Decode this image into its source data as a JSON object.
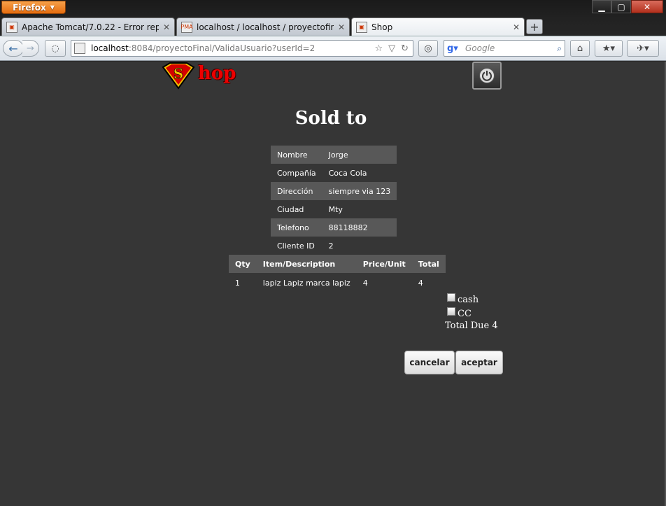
{
  "browser": {
    "menu_label": "Firefox",
    "tabs": [
      {
        "title": "Apache Tomcat/7.0.22 - Error report",
        "favicon": "tomcat-icon",
        "active": false
      },
      {
        "title": "localhost / localhost / proyectofinal / ...",
        "favicon": "pma-icon",
        "active": false
      },
      {
        "title": "Shop",
        "favicon": "page-icon",
        "active": true
      }
    ],
    "url_host": "localhost",
    "url_path": ":8084/proyectoFinal/ValidaUsuario?userId=2",
    "search_placeholder": "Google",
    "window_controls": [
      "minimize",
      "maximize",
      "close"
    ]
  },
  "page": {
    "logo_text": "hop",
    "heading": "Sold to",
    "customer": [
      {
        "label": "Nombre",
        "value": "Jorge"
      },
      {
        "label": "Compañía",
        "value": "Coca Cola"
      },
      {
        "label": "Dirección",
        "value": "siempre via 123"
      },
      {
        "label": "Ciudad",
        "value": "Mty"
      },
      {
        "label": "Telefono",
        "value": "88118882"
      },
      {
        "label": "Cliente ID",
        "value": "2"
      }
    ],
    "items_table": {
      "headers": [
        "Qty",
        "Item/Description",
        "Price/Unit",
        "Total"
      ],
      "rows": [
        [
          "1",
          "lapiz Lapiz marca lapiz",
          "4",
          "4"
        ]
      ]
    },
    "payment": {
      "cash_label": "cash",
      "cc_label": "CC",
      "total_label": "Total Due 4"
    },
    "buttons": {
      "cancel": "cancelar",
      "accept": "aceptar"
    },
    "colors": {
      "page_bg": "#363636",
      "row_dark": "#585858",
      "text": "#ffffff"
    }
  }
}
